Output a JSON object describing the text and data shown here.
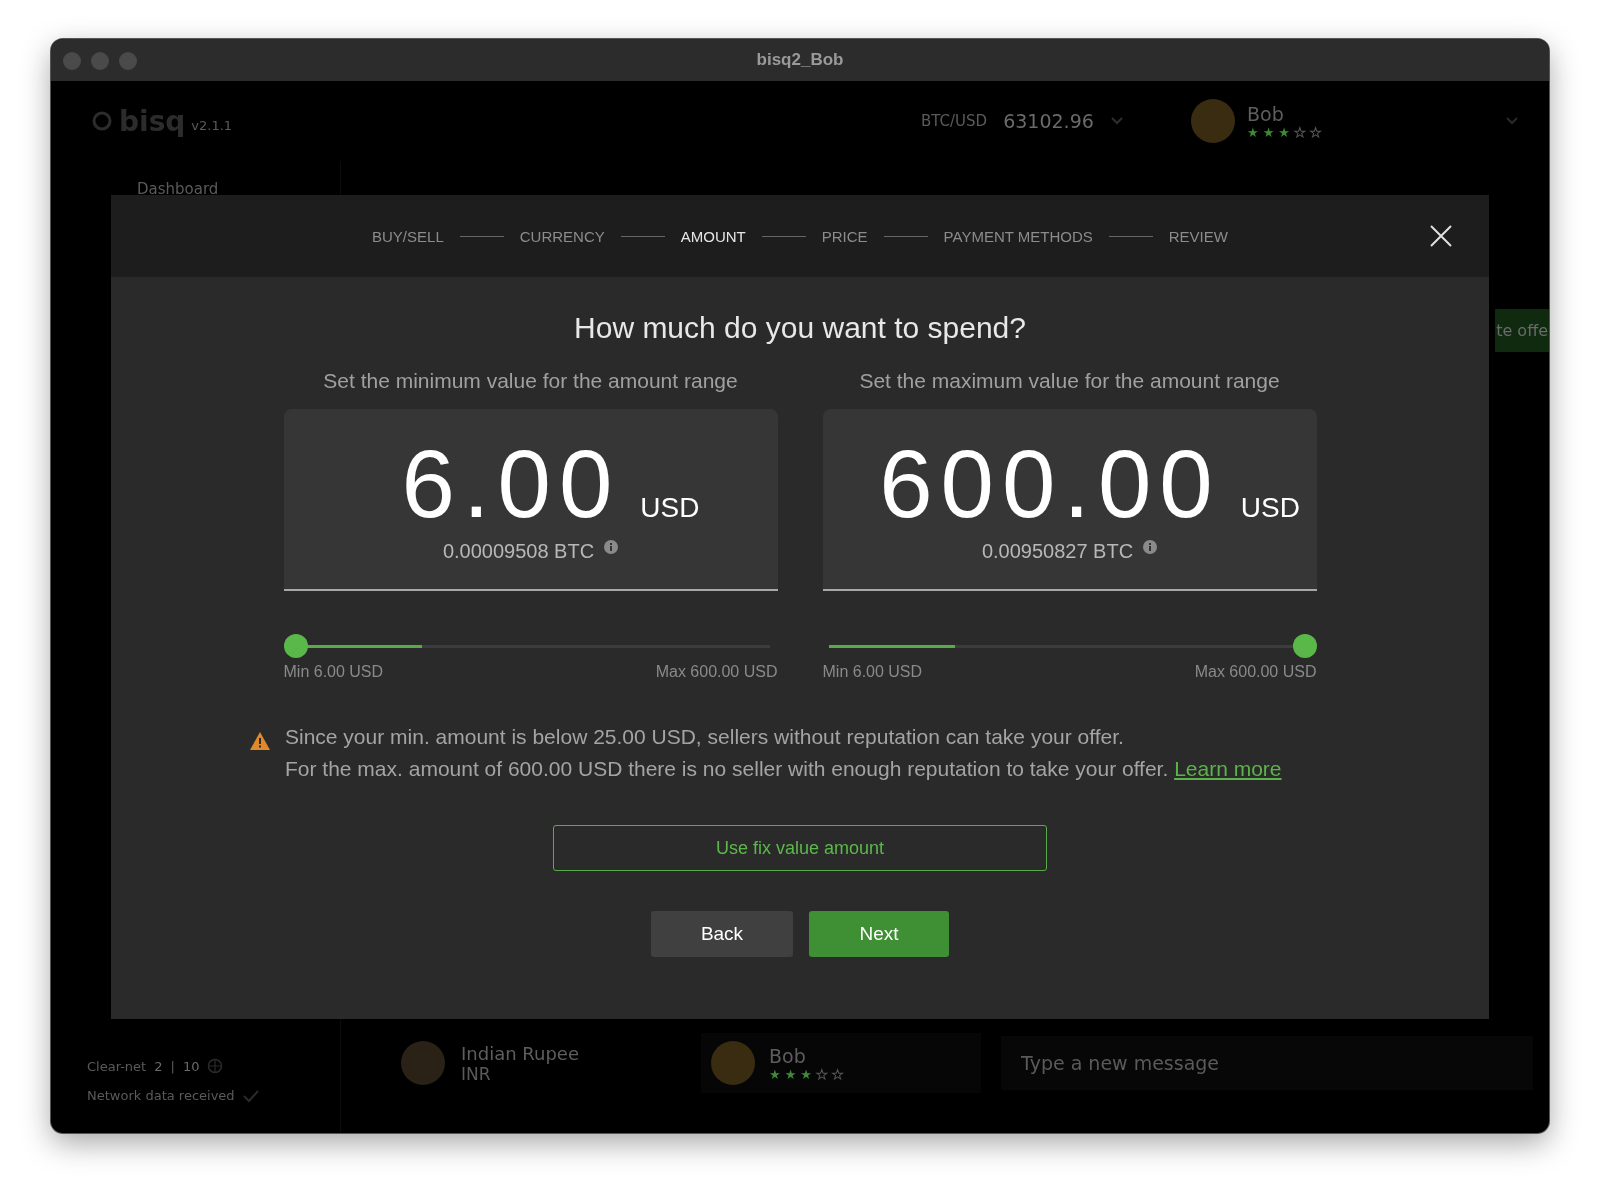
{
  "window": {
    "title": "bisq2_Bob"
  },
  "background": {
    "logo": "bisq",
    "version": "v2.1.1",
    "market": {
      "pair": "BTC/USD",
      "price": "63102.96"
    },
    "user": {
      "name": "Bob",
      "stars": 3
    },
    "sidebar": {
      "items": [
        {
          "label": "Dashboard"
        }
      ]
    },
    "network": {
      "label": "Clear-net",
      "peers": "2",
      "separator": "|",
      "max": "10",
      "status": "Network data received"
    },
    "offer_button": "te offe",
    "markets": [
      {
        "name": "Indian Rupee",
        "code": "INR"
      }
    ],
    "chat": {
      "user": {
        "name": "Bob",
        "stars": 3
      },
      "placeholder": "Type a new message"
    }
  },
  "wizard": {
    "steps": [
      {
        "label": "BUY/SELL",
        "selected": false
      },
      {
        "label": "CURRENCY",
        "selected": false
      },
      {
        "label": "AMOUNT",
        "selected": true
      },
      {
        "label": "PRICE",
        "selected": false
      },
      {
        "label": "PAYMENT METHODS",
        "selected": false
      },
      {
        "label": "REVIEW",
        "selected": false
      }
    ],
    "title": "How much do you want to spend?",
    "ranges": [
      {
        "caption": "Set the minimum value for the amount range",
        "value": "6.00",
        "currency": "USD",
        "btc": "0.00009508 BTC",
        "level": 0,
        "min_label": "Min 6.00 USD",
        "max_label": "Max 600.00 USD"
      },
      {
        "caption": "Set the maximum value for the amount range",
        "value": "600.00",
        "currency": "USD",
        "btc": "0.00950827 BTC",
        "level": 1,
        "min_label": "Min 6.00 USD",
        "max_label": "Max 600.00 USD"
      }
    ],
    "warning": {
      "lines": [
        "Since your min. amount is below 25.00 USD, sellers without reputation can take your offer.",
        "For the max. amount of 600.00 USD there is no seller with enough reputation to take your offer."
      ],
      "link": "Learn more"
    },
    "fix_button": "Use fix value amount",
    "buttons": [
      {
        "label": "Back",
        "kind": "secondary"
      },
      {
        "label": "Next",
        "kind": "primary"
      }
    ]
  }
}
